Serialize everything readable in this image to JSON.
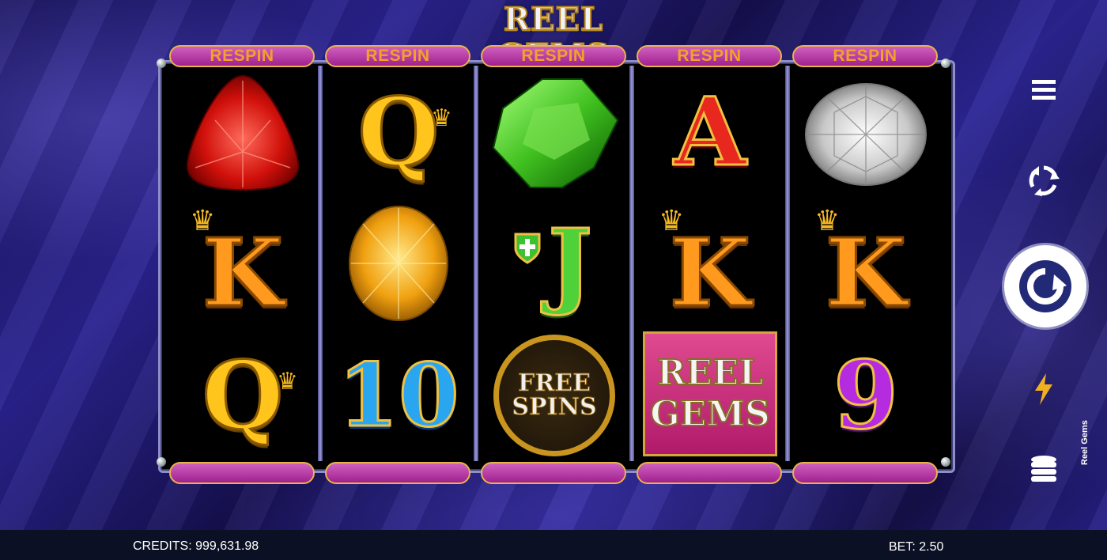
{
  "game": {
    "logo_text": "REEL GEMS",
    "side_name": "Reel Gems"
  },
  "reels": [
    {
      "respin_label": "RESPIN",
      "symbols": [
        "red-gem",
        "K",
        "Q"
      ]
    },
    {
      "respin_label": "RESPIN",
      "symbols": [
        "Q",
        "yellow-gem",
        "10"
      ]
    },
    {
      "respin_label": "RESPIN",
      "symbols": [
        "green-gem",
        "J",
        "free-spins"
      ]
    },
    {
      "respin_label": "RESPIN",
      "symbols": [
        "A",
        "K",
        "reel-gems"
      ]
    },
    {
      "respin_label": "RESPIN",
      "symbols": [
        "white-diamond",
        "K",
        "9"
      ]
    }
  ],
  "symbols_text": {
    "q": "Q",
    "k": "K",
    "j": "J",
    "a": "A",
    "ten": "10",
    "nine": "9",
    "free_spins_line1": "FREE",
    "free_spins_line2": "SPINS",
    "reel_gems_line1": "REEL",
    "reel_gems_line2": "GEMS"
  },
  "controls": [
    "menu-icon",
    "autoplay-icon",
    "spin-icon",
    "turbo-icon",
    "bet-stack-icon"
  ],
  "status": {
    "credits_label": "CREDITS:",
    "credits_value": "999,631.98",
    "bet_label": "BET:",
    "bet_value": "2.50"
  },
  "colors": {
    "background": "#1c1660",
    "plate": "#a0208e",
    "gold": "#e8b44a",
    "statusbar": "#0c1024"
  }
}
